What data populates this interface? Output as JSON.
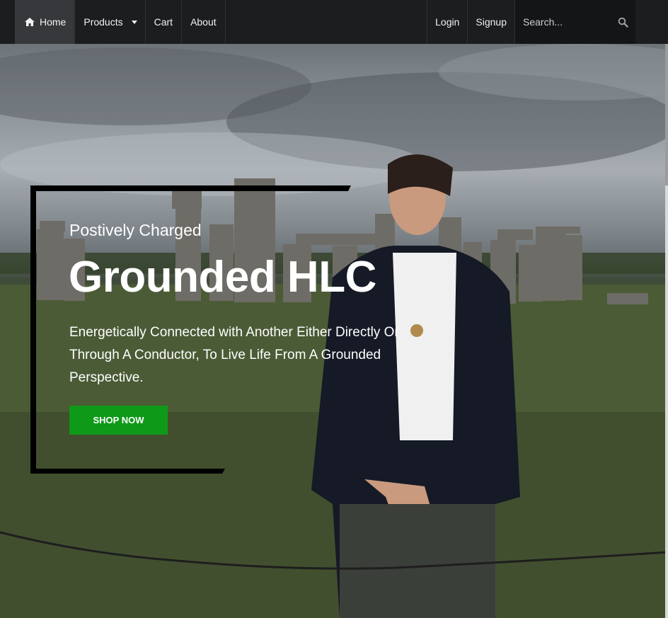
{
  "nav": {
    "home_label": "Home",
    "products_label": "Products",
    "cart_label": "Cart",
    "about_label": "About",
    "login_label": "Login",
    "signup_label": "Signup",
    "search_placeholder": "Search..."
  },
  "hero": {
    "subtitle": "Postively Charged",
    "headline": "Grounded HLC",
    "tagline": "Energetically Connected with Another Either Directly Or Through A Conductor, To Live Life From A Grounded Perspective.",
    "cta_label": "SHOP NOW"
  },
  "colors": {
    "navbar": "#1c1d1f",
    "cta": "#0f9918",
    "frame": "#000000"
  },
  "icons": {
    "home": "home-icon",
    "caret": "chevron-down-icon",
    "search": "search-icon"
  }
}
